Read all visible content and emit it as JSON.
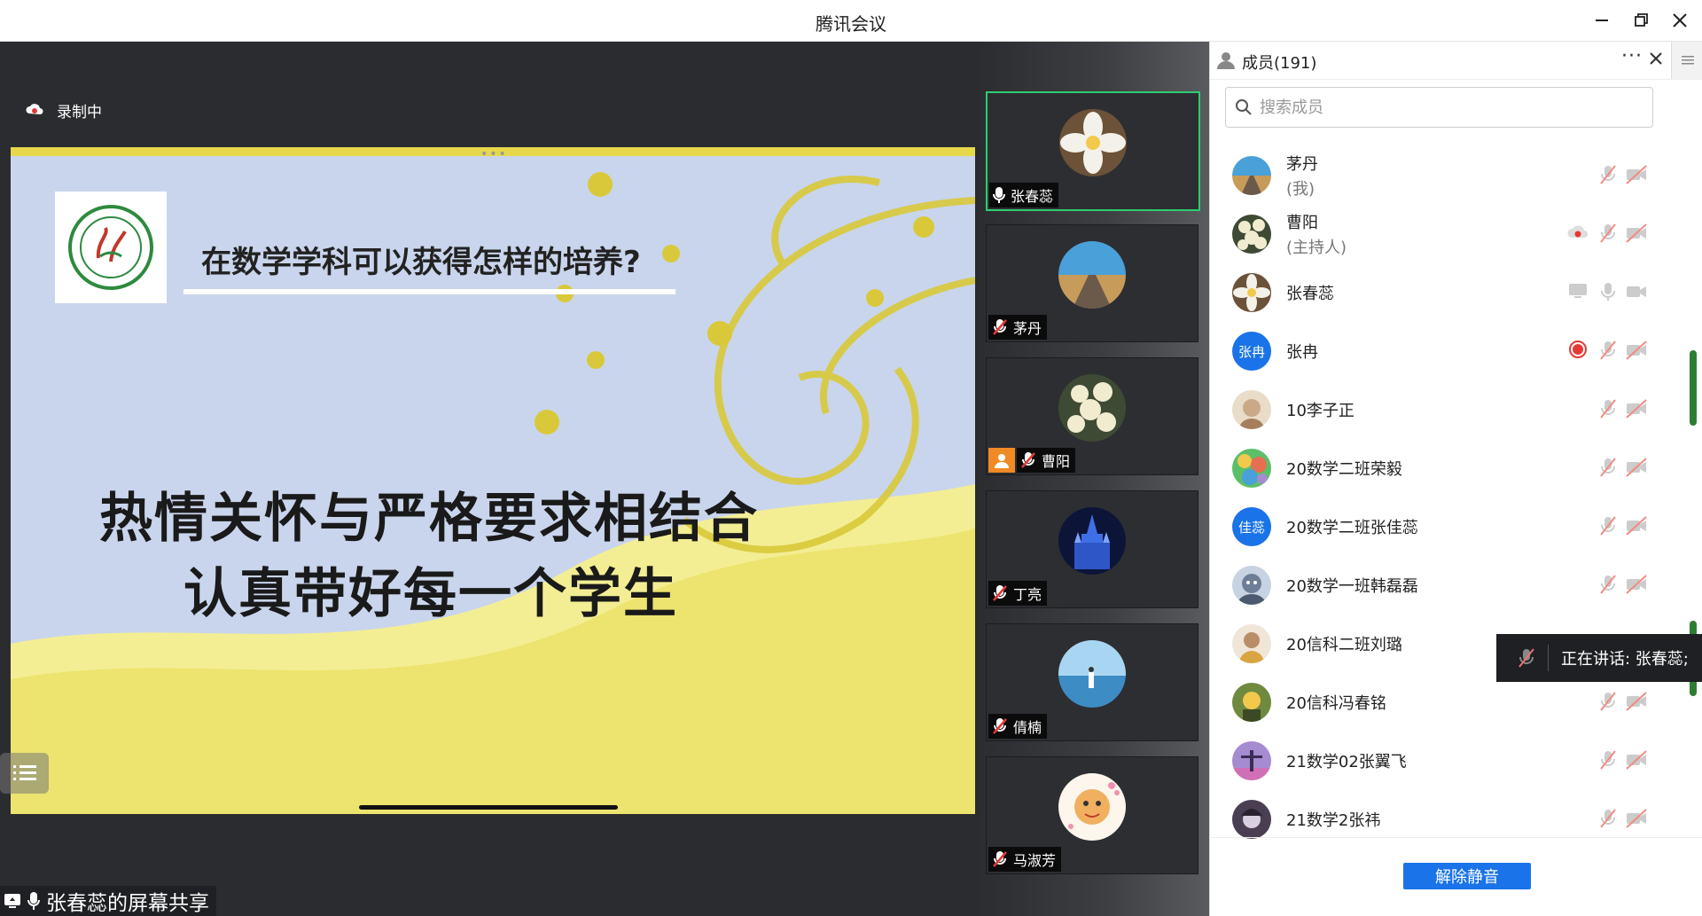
{
  "window": {
    "title": "腾讯会议"
  },
  "stage": {
    "recording_label": "录制中",
    "slide": {
      "subtitle": "在数学学科可以获得怎样的培养?",
      "line1": "热情关怀与严格要求相结合",
      "line2": "认真带好每一个学生"
    },
    "share_label": "张春蕊的屏幕共享"
  },
  "video_tiles": [
    {
      "name": "张春蕊",
      "muted": false,
      "active": true,
      "avatar": "flower-avatar",
      "color": "#7a5a3a"
    },
    {
      "name": "茅丹",
      "muted": true,
      "active": false,
      "avatar": "road-avatar",
      "color": "#c79b5a"
    },
    {
      "name": "曹阳",
      "muted": true,
      "active": false,
      "host": true,
      "avatar": "roses-avatar",
      "color": "#9fae7d"
    },
    {
      "name": "丁亮",
      "muted": true,
      "active": false,
      "avatar": "castle-avatar",
      "color": "#1c2a6a"
    },
    {
      "name": "倩楠",
      "muted": true,
      "active": false,
      "avatar": "sea-avatar",
      "color": "#8cc3e8"
    },
    {
      "name": "马淑芳",
      "muted": true,
      "active": false,
      "avatar": "cartoon-avatar",
      "color": "#f0b060"
    }
  ],
  "panel": {
    "title": "成员(191)",
    "search_placeholder": "搜索成员",
    "members": [
      {
        "name": "茅丹",
        "sub": "(我)",
        "avatar_color": "#c79b5a",
        "avatar_text": ""
      },
      {
        "name": "曹阳",
        "sub": "(主持人)",
        "avatar_color": "#9fae7d",
        "avatar_text": "",
        "recording": true
      },
      {
        "name": "张春蕊",
        "sub": "",
        "avatar_color": "#7a5a3a",
        "avatar_text": "",
        "speaking": true
      },
      {
        "name": "张冉",
        "sub": "",
        "avatar_color": "#1a73e8",
        "avatar_text": "张冉",
        "rec_dot": true
      },
      {
        "name": "10李子正",
        "sub": "",
        "avatar_color": "#c9a987",
        "avatar_text": ""
      },
      {
        "name": "20数学二班荣毅",
        "sub": "",
        "avatar_color": "#8fbf7a",
        "avatar_text": ""
      },
      {
        "name": "20数学二班张佳蕊",
        "sub": "",
        "avatar_color": "#1a73e8",
        "avatar_text": "佳蕊"
      },
      {
        "name": "20数学一班韩磊磊",
        "sub": "",
        "avatar_color": "#6d7e96",
        "avatar_text": ""
      },
      {
        "name": "20信科二班刘璐",
        "sub": "",
        "avatar_color": "#b88d68",
        "avatar_text": ""
      },
      {
        "name": "20信科冯春铭",
        "sub": "",
        "avatar_color": "#6f8a3e",
        "avatar_text": ""
      },
      {
        "name": "21数学02张翼飞",
        "sub": "",
        "avatar_color": "#a58bd0",
        "avatar_text": ""
      },
      {
        "name": "21数学2张祎",
        "sub": "",
        "avatar_color": "#4a3f52",
        "avatar_text": ""
      }
    ],
    "speaking_tip": "正在讲话: 张春蕊;",
    "unmute_label": "解除静音"
  },
  "colors": {
    "accent": "#1a73e8",
    "active_border": "#2ecc71",
    "recording_red": "#e53935",
    "slide_bg": "#c9d5ec",
    "slide_gold": "#e6d84a"
  }
}
